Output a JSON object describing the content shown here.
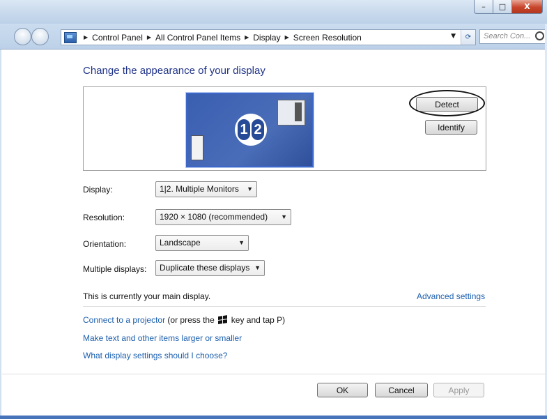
{
  "window": {
    "controls": {
      "minimize": "–",
      "maximize": "□",
      "close": "X"
    }
  },
  "address_bar": {
    "breadcrumb": [
      "Control Panel",
      "All Control Panel Items",
      "Display",
      "Screen Resolution"
    ],
    "search_placeholder": "Search Con..."
  },
  "page": {
    "heading": "Change the appearance of your display",
    "preview": {
      "monitor_label_1": "1",
      "monitor_label_2": "2",
      "detect_label": "Detect",
      "identify_label": "Identify"
    },
    "settings": {
      "display_label": "Display:",
      "display_value": "1|2. Multiple Monitors",
      "resolution_label": "Resolution:",
      "resolution_value": "1920 × 1080 (recommended)",
      "orientation_label": "Orientation:",
      "orientation_value": "Landscape",
      "multiple_label": "Multiple displays:",
      "multiple_value": "Duplicate these displays"
    },
    "main_display_note": "This is currently your main display.",
    "advanced_link": "Advanced settings",
    "projector_link": "Connect to a projector",
    "projector_text_before": "(or press the",
    "projector_text_after": "key and tap P)",
    "text_size_link": "Make text and other items larger or smaller",
    "which_settings_link": "What display settings should I choose?"
  },
  "footer": {
    "ok_label": "OK",
    "cancel_label": "Cancel",
    "apply_label": "Apply"
  }
}
